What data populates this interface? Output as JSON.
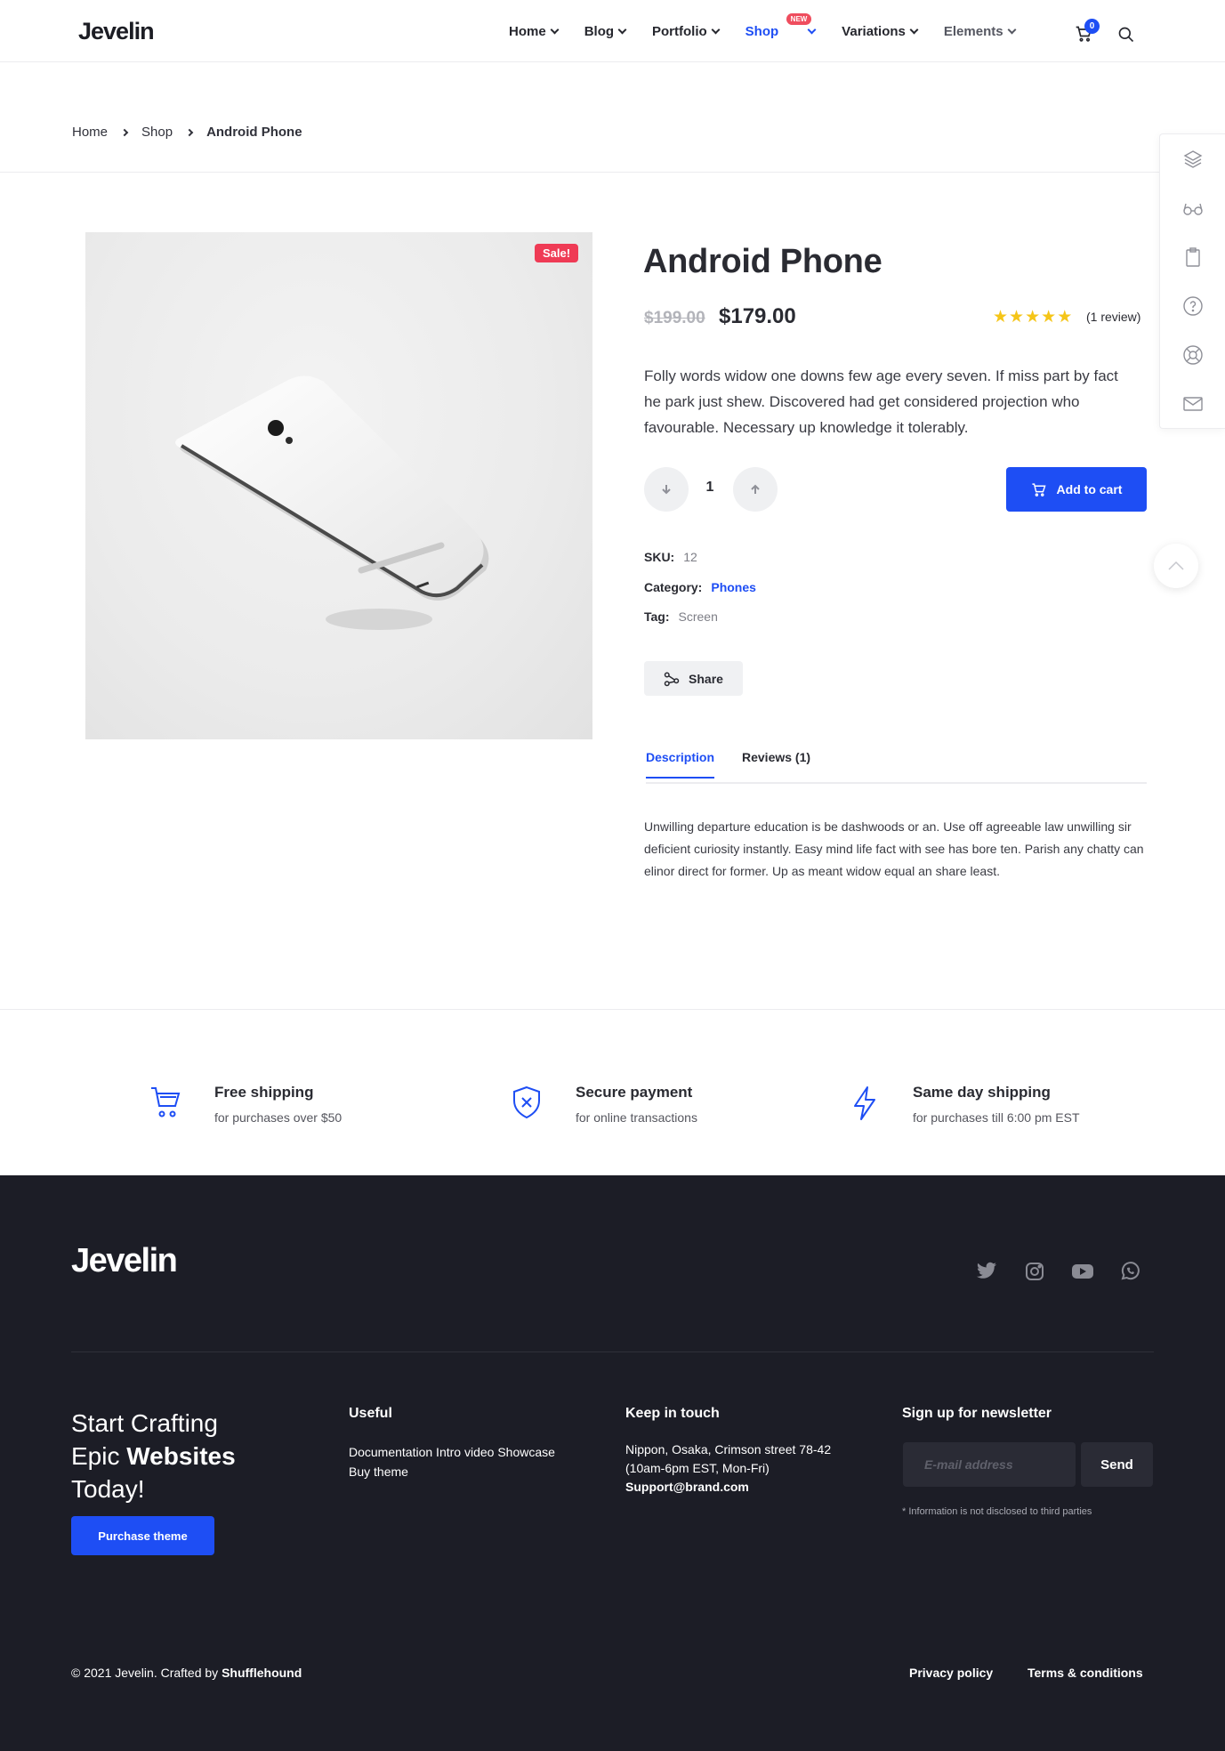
{
  "brand": {
    "logo": "Jevelin"
  },
  "nav": {
    "items": [
      {
        "label": "Home"
      },
      {
        "label": "Blog"
      },
      {
        "label": "Portfolio"
      },
      {
        "label": "Shop",
        "badge": "NEW"
      },
      {
        "label": "Variations"
      },
      {
        "label": "Elements"
      }
    ],
    "cart_count": "0"
  },
  "breadcrumb": [
    "Home",
    "Shop",
    "Android Phone"
  ],
  "product": {
    "sale_badge": "Sale!",
    "title": "Android Phone",
    "old_price": "$199.00",
    "price": "$179.00",
    "rating": 5,
    "reviews_text": "(1 review)",
    "description": "Folly words widow one downs few age every seven. If miss part by fact he park just shew. Discovered had get considered projection who favourable. Necessary up knowledge it tolerably.",
    "quantity": "1",
    "add_to_cart": "Add to cart",
    "sku_label": "SKU:",
    "sku": "12",
    "category_label": "Category:",
    "category": "Phones",
    "tag_label": "Tag:",
    "tag": "Screen",
    "share": "Share"
  },
  "tabs": {
    "items": [
      "Description",
      "Reviews (1)"
    ],
    "description_text": "Unwilling departure education is be dashwoods or an. Use off agreeable law unwilling sir deficient curiosity instantly. Easy mind life fact with see has bore ten. Parish any chatty can elinor direct for former. Up as meant widow equal an share least."
  },
  "features": [
    {
      "title": "Free shipping",
      "subtitle": "for purchases over $50",
      "icon": "cart-icon"
    },
    {
      "title": "Secure payment",
      "subtitle": "for online transactions",
      "icon": "shield-icon"
    },
    {
      "title": "Same day shipping",
      "subtitle": "for purchases till 6:00 pm EST",
      "icon": "bolt-icon"
    }
  ],
  "footer": {
    "logo": "Jevelin",
    "cta_line1": "Start Crafting",
    "cta_line2_a": "Epic ",
    "cta_line2_b": "Websites",
    "cta_line3": "Today!",
    "purchase": "Purchase theme",
    "useful_title": "Useful",
    "useful_line1": "Documentation Intro video Showcase",
    "useful_line2": "Buy theme",
    "contact_title": "Keep in touch",
    "contact_line1": "Nippon, Osaka, Crimson street 78-42",
    "contact_line2": "(10am-6pm EST, Mon-Fri)",
    "contact_email": "Support@brand.com",
    "newsletter_title": "Sign up for newsletter",
    "newsletter_placeholder": "E-mail address",
    "newsletter_send": "Send",
    "newsletter_note": "* Information is not disclosed to third parties",
    "copyright_a": "© 2021 Jevelin. Crafted by ",
    "copyright_b": "Shufflehound",
    "privacy": "Privacy policy",
    "terms": "Terms & conditions"
  },
  "colors": {
    "accent": "#1e4ef4",
    "sale": "#ef3b55",
    "footer_bg": "#1c1d26",
    "star": "#f5c518"
  }
}
